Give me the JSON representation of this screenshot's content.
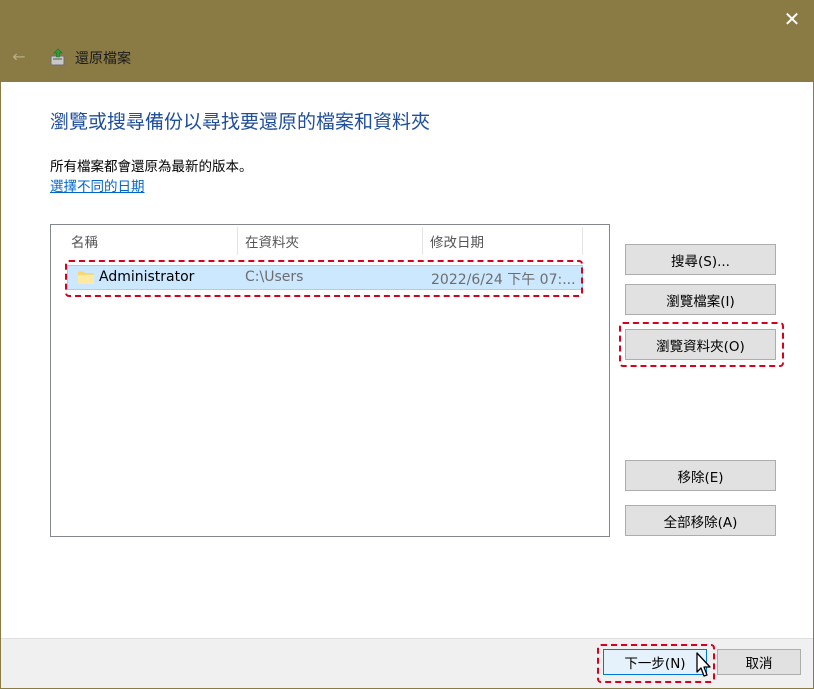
{
  "window": {
    "title": "還原檔案",
    "close_glyph": "✕",
    "back_glyph": "←",
    "accent_color": "#8a7a44"
  },
  "main": {
    "heading": "瀏覽或搜尋備份以尋找要還原的檔案和資料夾",
    "description": "所有檔案都會還原為最新的版本。",
    "link": "選擇不同的日期"
  },
  "list": {
    "columns": [
      "名稱",
      "在資料夾",
      "修改日期"
    ],
    "rows": [
      {
        "name": "Administrator",
        "folder": "C:\\Users",
        "modified": "2022/6/24 下午 07:..."
      }
    ]
  },
  "buttons": {
    "search": "搜尋(S)...",
    "browse_files": "瀏覽檔案(I)",
    "browse_folders": "瀏覽資料夾(O)",
    "remove": "移除(E)",
    "remove_all": "全部移除(A)"
  },
  "footer": {
    "next": "下一步(N)",
    "cancel": "取消"
  },
  "highlight_color": "#d8001e"
}
